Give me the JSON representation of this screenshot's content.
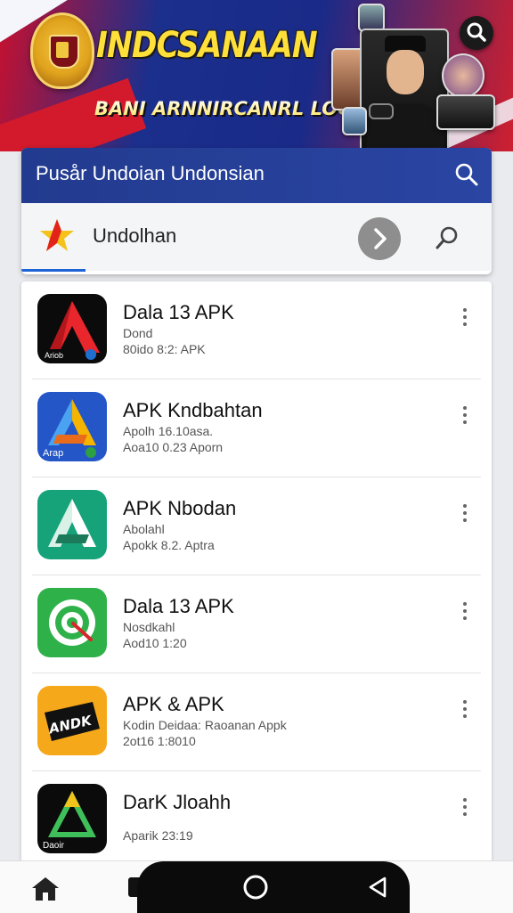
{
  "banner": {
    "title": "INDCSANAAN",
    "subtitle": "BANI ARNNIRCANRL LOOI"
  },
  "header": {
    "title": "Pusår Undoian Undonsian",
    "search_query": "Undolhan"
  },
  "apps": [
    {
      "name": "Dala 13 APK",
      "line1": "Dond",
      "line2": "80ido 8:2: APK",
      "icon": "red-a-icon"
    },
    {
      "name": "APK Kndbahtan",
      "line1": "Apolh 16.10asa.",
      "line2": "Aoa10 0.23 Aporn",
      "icon": "blue-a-icon"
    },
    {
      "name": "APK Nbodan",
      "line1": "Abolahl",
      "line2": "Apokk 8.2. Aptra",
      "icon": "green-a-icon"
    },
    {
      "name": "Dala 13 APK",
      "line1": "Nosdkahl",
      "line2": "Aod10 1:20",
      "icon": "target-icon"
    },
    {
      "name": "APK & APK",
      "line1": "Kodin Deidaa: Raoanan Appk",
      "line2": "2ot16 1:8010",
      "icon": "yellow-badge-icon"
    },
    {
      "name": "DarK Jloahh",
      "line1": "",
      "line2": "Aparik 23:19",
      "icon": "triangle-icon"
    }
  ],
  "colors": {
    "header_blue": "#223b8f",
    "accent_blue": "#1e64d6",
    "banner_yellow": "#ffe03a"
  },
  "bottom_nav": {
    "items": [
      "home-icon",
      "recents-icon",
      "circle-home-icon",
      "back-icon"
    ]
  }
}
